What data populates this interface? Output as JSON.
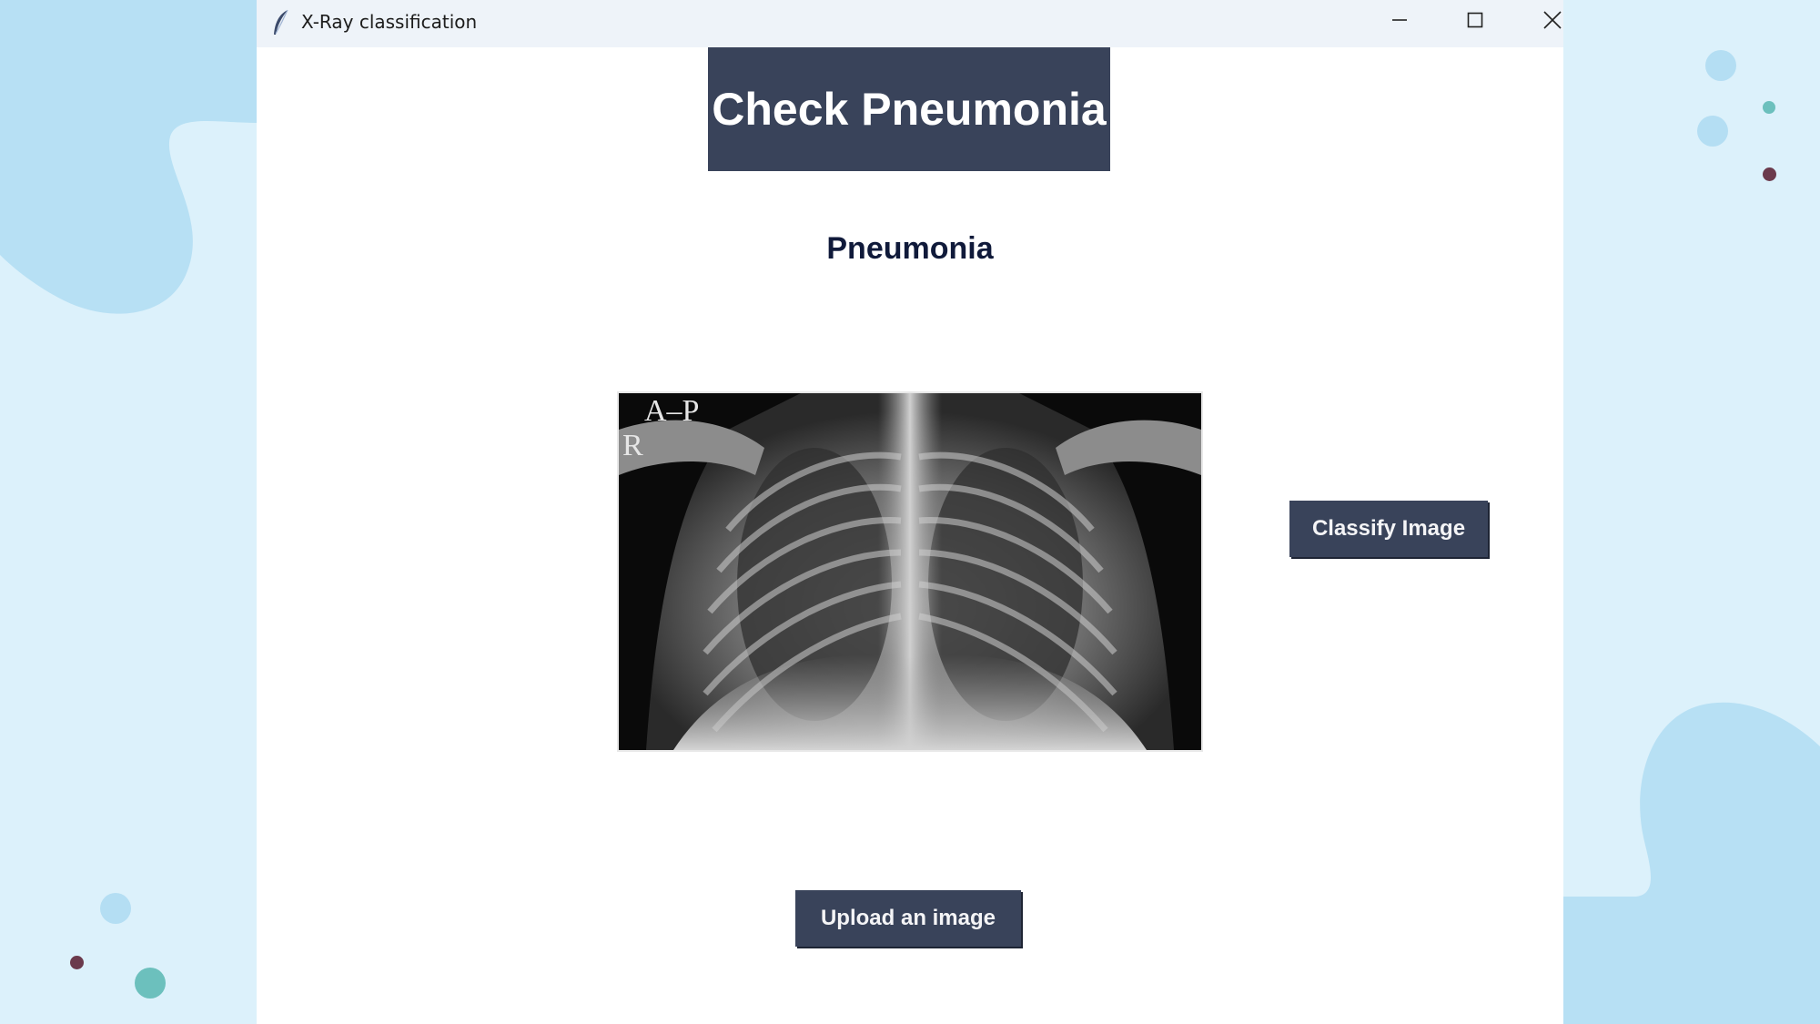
{
  "window": {
    "title": "X-Ray classification",
    "icon": "feather-icon",
    "controls": [
      "minimize-icon",
      "maximize-icon",
      "close-icon"
    ]
  },
  "app": {
    "header": "Check Pneumonia",
    "result": "Pneumonia",
    "xray_markers": {
      "view": "A–P",
      "side": "R"
    },
    "classify_label": "Classify Image",
    "upload_label": "Upload an image"
  },
  "colors": {
    "accent": "#39435a",
    "result_text": "#101a3a",
    "background": "#dcf1fb",
    "blob": "#b7e0f4"
  }
}
